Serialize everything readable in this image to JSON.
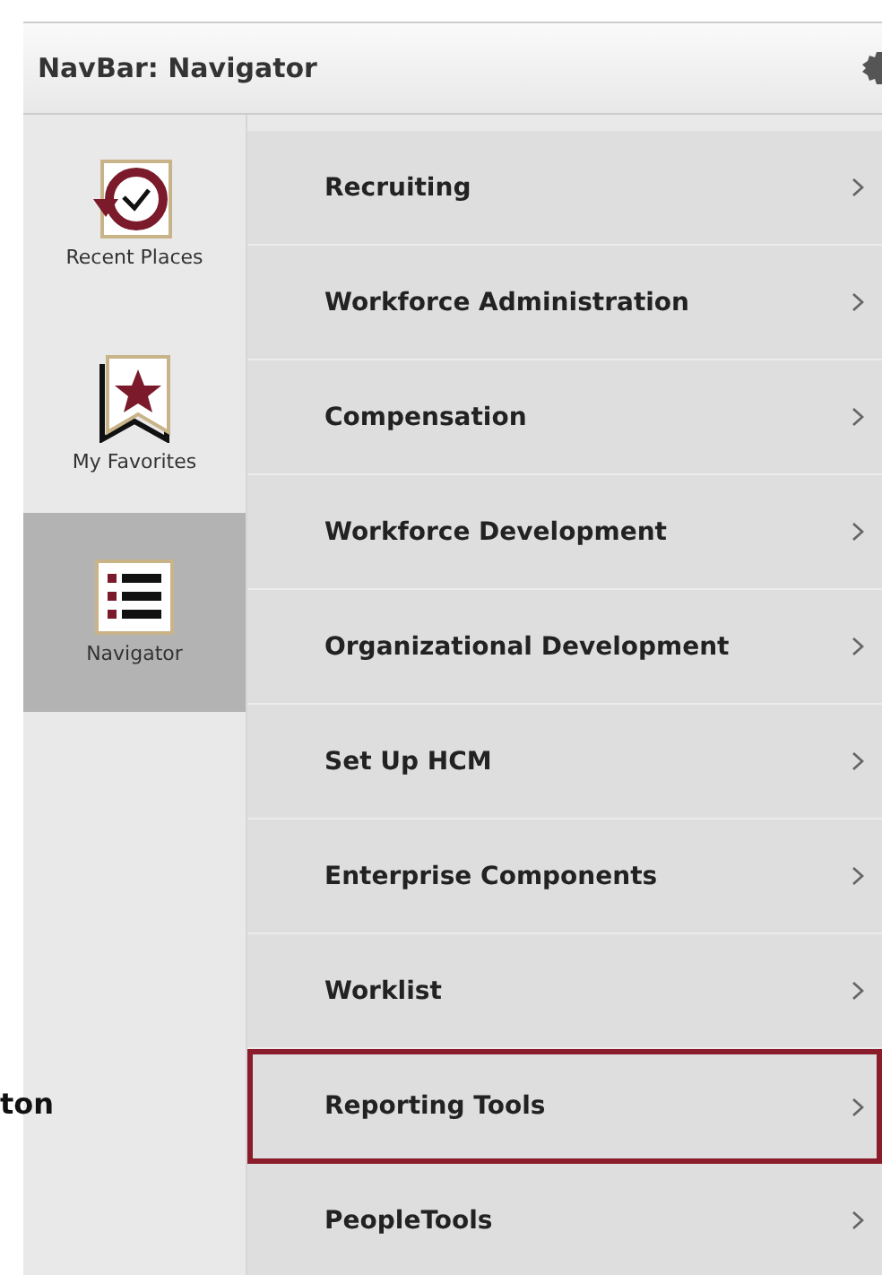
{
  "header": {
    "title": "NavBar: Navigator"
  },
  "sidebar": {
    "items": [
      {
        "label": "Recent Places",
        "kind": "recent",
        "selected": false
      },
      {
        "label": "My Favorites",
        "kind": "favorites",
        "selected": false
      },
      {
        "label": "Navigator",
        "kind": "navigator",
        "selected": true
      }
    ]
  },
  "menu": {
    "items": [
      {
        "label": "Recruiting",
        "highlighted": false
      },
      {
        "label": "Workforce Administration",
        "highlighted": false
      },
      {
        "label": "Compensation",
        "highlighted": false
      },
      {
        "label": "Workforce Development",
        "highlighted": false
      },
      {
        "label": "Organizational Development",
        "highlighted": false
      },
      {
        "label": "Set Up HCM",
        "highlighted": false
      },
      {
        "label": "Enterprise Components",
        "highlighted": false
      },
      {
        "label": "Worklist",
        "highlighted": false
      },
      {
        "label": "Reporting Tools",
        "highlighted": true
      },
      {
        "label": "PeopleTools",
        "highlighted": false
      }
    ]
  },
  "annotation": {
    "text": "ton"
  }
}
